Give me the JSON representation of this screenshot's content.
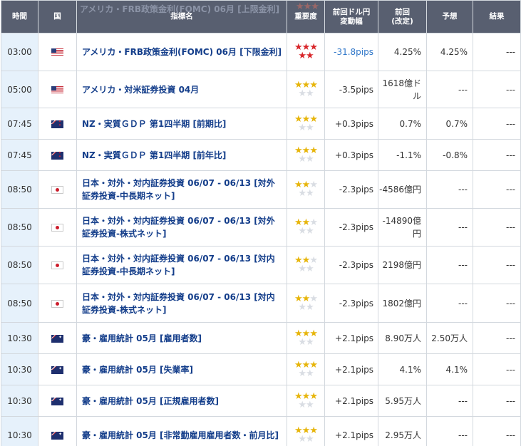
{
  "header": {
    "time": "時間",
    "country": "国",
    "indicator": "指標名",
    "importance": "重要度",
    "change": "前回ドル円\n変動幅",
    "previous": "前回\n(改定)",
    "forecast": "予想",
    "result": "結果",
    "ghost_text": "アメリカ・FRB政策金利(FOMC) 06月 [上限金利]"
  },
  "colors": {
    "header_bg": "#585f70",
    "time_bg": "#e6f1fb",
    "name_text": "#133d8a",
    "star_red": "#d8262a",
    "star_gold": "#e7b50b",
    "star_off": "#d9dde3",
    "change_highlight": "#3077c9"
  },
  "rows": [
    {
      "time": "03:00",
      "country_icon": "us-flag-icon",
      "name": "アメリカ・FRB政策金利(FOMC) 06月 [下限金利]",
      "stars": 5,
      "change": "-31.8pips",
      "previous": "4.25%",
      "forecast": "4.25%",
      "result": "---"
    },
    {
      "time": "05:00",
      "country_icon": "us-flag-icon",
      "name": "アメリカ・対米証券投資 04月",
      "stars": 3,
      "change": "-3.5pips",
      "previous": "1618億ドル",
      "forecast": "---",
      "result": "---"
    },
    {
      "time": "07:45",
      "country_icon": "nz-flag-icon",
      "name": "NZ・実質ＧＤＰ 第1四半期 [前期比]",
      "stars": 3,
      "change": "+0.3pips",
      "previous": "0.7%",
      "forecast": "0.7%",
      "result": "---"
    },
    {
      "time": "07:45",
      "country_icon": "nz-flag-icon",
      "name": "NZ・実質ＧＤＰ 第1四半期 [前年比]",
      "stars": 3,
      "change": "+0.3pips",
      "previous": "-1.1%",
      "forecast": "-0.8%",
      "result": "---"
    },
    {
      "time": "08:50",
      "country_icon": "jp-flag-icon",
      "name": "日本・対外・対内証券投資 06/07 - 06/13 [対外証券投資-中長期ネット]",
      "stars": 2,
      "change": "-2.3pips",
      "previous": "-4586億円",
      "forecast": "---",
      "result": "---"
    },
    {
      "time": "08:50",
      "country_icon": "jp-flag-icon",
      "name": "日本・対外・対内証券投資 06/07 - 06/13 [対外証券投資-株式ネット]",
      "stars": 2,
      "change": "-2.3pips",
      "previous": "-14890億円",
      "forecast": "---",
      "result": "---"
    },
    {
      "time": "08:50",
      "country_icon": "jp-flag-icon",
      "name": "日本・対外・対内証券投資 06/07 - 06/13 [対内証券投資-中長期ネット]",
      "stars": 2,
      "change": "-2.3pips",
      "previous": "2198億円",
      "forecast": "---",
      "result": "---"
    },
    {
      "time": "08:50",
      "country_icon": "jp-flag-icon",
      "name": "日本・対外・対内証券投資 06/07 - 06/13 [対内証券投資-株式ネット]",
      "stars": 2,
      "change": "-2.3pips",
      "previous": "1802億円",
      "forecast": "---",
      "result": "---"
    },
    {
      "time": "10:30",
      "country_icon": "au-flag-icon",
      "name": "豪・雇用統計 05月 [雇用者数]",
      "stars": 3,
      "change": "+2.1pips",
      "previous": "8.90万人",
      "forecast": "2.50万人",
      "result": "---"
    },
    {
      "time": "10:30",
      "country_icon": "au-flag-icon",
      "name": "豪・雇用統計 05月 [失業率]",
      "stars": 3,
      "change": "+2.1pips",
      "previous": "4.1%",
      "forecast": "4.1%",
      "result": "---"
    },
    {
      "time": "10:30",
      "country_icon": "au-flag-icon",
      "name": "豪・雇用統計 05月 [正規雇用者数]",
      "stars": 3,
      "change": "+2.1pips",
      "previous": "5.95万人",
      "forecast": "---",
      "result": "---"
    },
    {
      "time": "10:30",
      "country_icon": "au-flag-icon",
      "name": "豪・雇用統計 05月 [非常勤雇用雇用者数・前月比]",
      "stars": 3,
      "change": "+2.1pips",
      "previous": "2.95万人",
      "forecast": "---",
      "result": "---"
    }
  ]
}
